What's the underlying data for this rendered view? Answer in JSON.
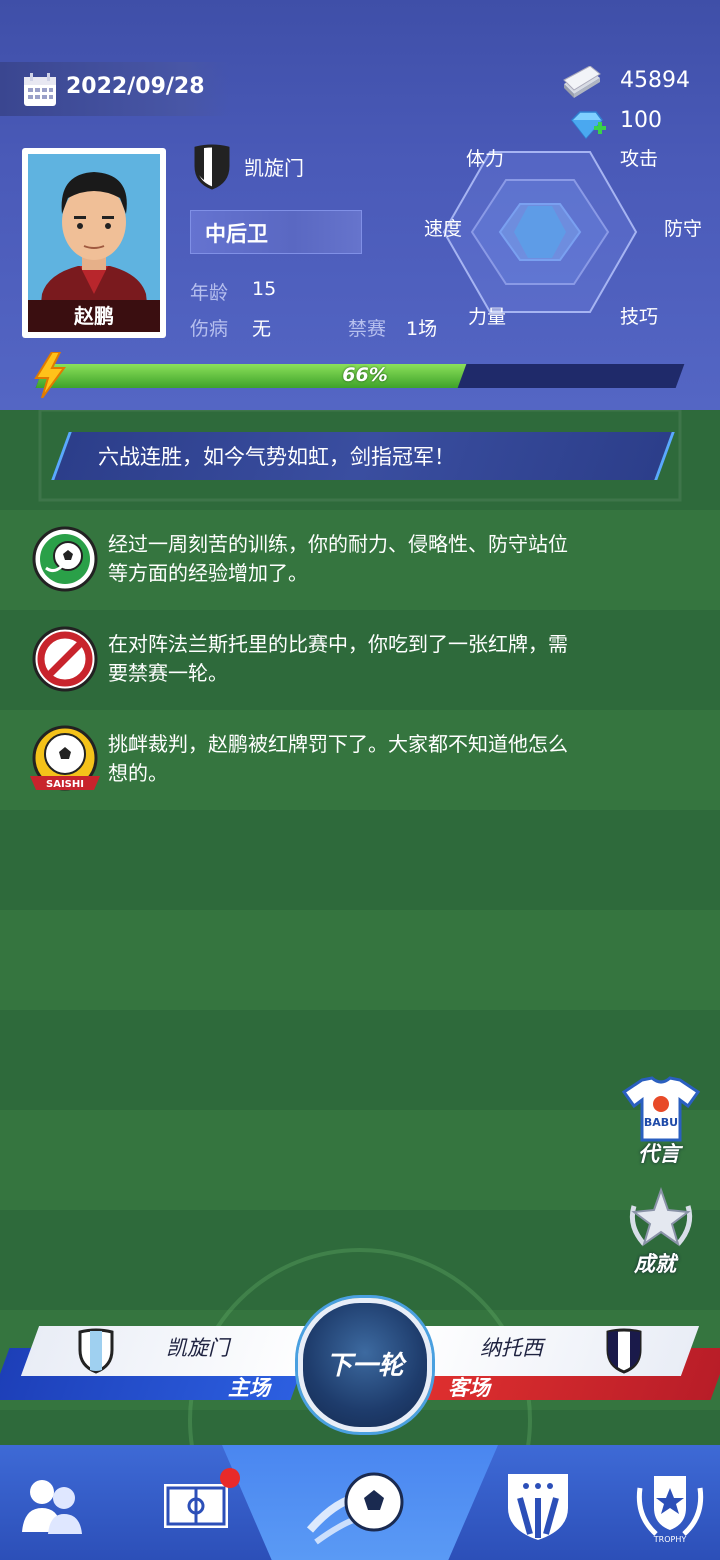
{
  "header": {
    "date": "2022/09/28",
    "money": "45894",
    "gems": "100"
  },
  "player": {
    "name": "赵鹏",
    "club": "凯旋门",
    "position": "中后卫",
    "age_label": "年龄",
    "age_value": "15",
    "injury_label": "伤病",
    "injury_value": "无",
    "ban_label": "禁赛",
    "ban_value": "1场"
  },
  "radar": {
    "labels": {
      "stamina": "体力",
      "attack": "攻击",
      "speed": "速度",
      "defense": "防守",
      "strength": "力量",
      "skill": "技巧"
    }
  },
  "progress": {
    "label": "66%",
    "value": 0.66
  },
  "headline": "六战连胜，如今气势如虹，剑指冠军！",
  "news": [
    {
      "icon": "soccer-ball-icon",
      "text_lines": [
        "经过一周刻苦的训练，你的耐力、侵略性、防守站位",
        "等方面的经验增加了。"
      ]
    },
    {
      "icon": "banned-icon",
      "text_lines": [
        "在对阵法兰斯托里的比赛中，你吃到了一张红牌，需",
        "要禁赛一轮。"
      ]
    },
    {
      "icon": "saishi-badge-icon",
      "text_lines": [
        "挑衅裁判，赵鹏被红牌罚下了。大家都不知道他怎么",
        "想的。"
      ]
    }
  ],
  "side_buttons": {
    "endorsement": "代言",
    "shirt_text": "BABU",
    "achievements": "成就"
  },
  "match": {
    "home_team": "凯旋门",
    "home_tag": "主场",
    "away_team": "纳托西",
    "away_tag": "客场",
    "next_button": "下一轮"
  },
  "badge_text": "SAISHI",
  "nav": {
    "trophy_text": "TROPHY"
  },
  "colors": {
    "header_bg": "#4a5ab8",
    "field_green": "#2e6a3b",
    "progress_green": "#5ec23a",
    "home_blue": "#1d3fb8",
    "away_red": "#d8282c",
    "nav_blue": "#3e6ad6"
  }
}
